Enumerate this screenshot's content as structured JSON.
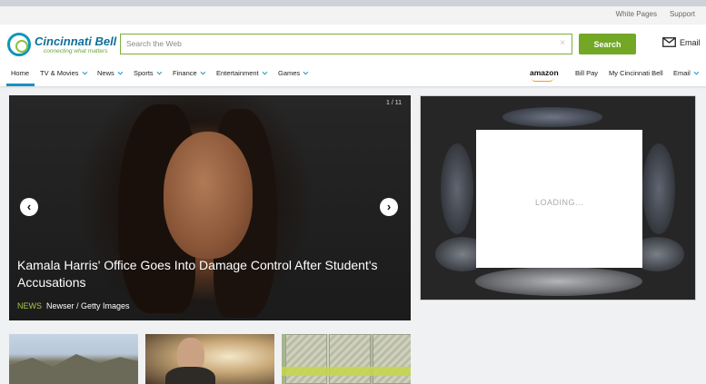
{
  "util_links": [
    "White Pages",
    "Support"
  ],
  "logo": {
    "name": "Cincinnati Bell",
    "tagline": "connecting what matters"
  },
  "search": {
    "placeholder": "Search the Web",
    "button_label": "Search",
    "clear_symbol": "×"
  },
  "email_link": {
    "label": "Email",
    "icon": "envelope-icon"
  },
  "nav": {
    "items": [
      {
        "label": "Home",
        "has_dropdown": false,
        "active": true
      },
      {
        "label": "TV & Movies",
        "has_dropdown": true
      },
      {
        "label": "News",
        "has_dropdown": true
      },
      {
        "label": "Sports",
        "has_dropdown": true
      },
      {
        "label": "Finance",
        "has_dropdown": true
      },
      {
        "label": "Entertainment",
        "has_dropdown": true
      },
      {
        "label": "Games",
        "has_dropdown": true
      }
    ],
    "right_items": [
      {
        "label": "amazon",
        "has_dropdown": false
      },
      {
        "label": "Bill Pay",
        "has_dropdown": false
      },
      {
        "label": "My Cincinnati Bell",
        "has_dropdown": false
      },
      {
        "label": "Email",
        "has_dropdown": true
      }
    ]
  },
  "hero": {
    "counter": "1 / 11",
    "title": "Kamala Harris' Office Goes Into Damage Control After Student's Accusations",
    "category": "NEWS",
    "source": "Newser / Getty Images",
    "prev_symbol": "‹",
    "next_symbol": "›"
  },
  "ad": {
    "loading_text": "LOADING..."
  },
  "thumbnails": [
    {
      "name": "mountain-landscape-thumbnail"
    },
    {
      "name": "man-portrait-thumbnail"
    },
    {
      "name": "currency-bills-thumbnail"
    }
  ],
  "colors": {
    "brand_blue": "#1a91c2",
    "search_green": "#72a826",
    "news_green": "#a8c84a"
  }
}
